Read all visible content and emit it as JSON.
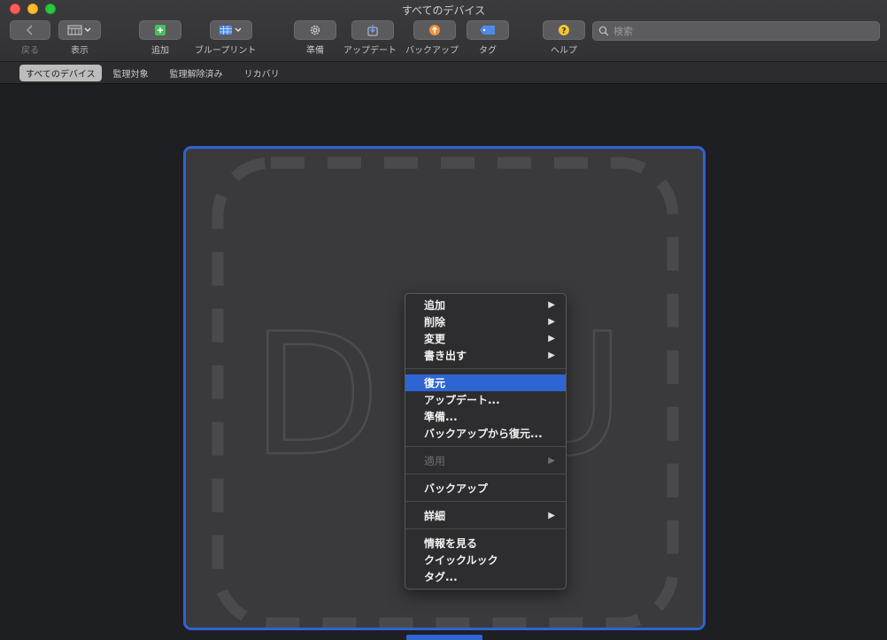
{
  "window": {
    "title": "すべてのデバイス"
  },
  "toolbar": {
    "back_label": "戻る",
    "view_label": "表示",
    "add_label": "追加",
    "blueprint_label": "ブループリント",
    "prepare_label": "準備",
    "update_label": "アップデート",
    "backup_label": "バックアップ",
    "tag_label": "タグ",
    "help_label": "ヘルプ"
  },
  "search": {
    "placeholder": "検索"
  },
  "filters": {
    "all_devices": "すべてのデバイス",
    "supervised": "監理対象",
    "unsupervised": "監理解除済み",
    "recovery": "リカバリ"
  },
  "device": {
    "placeholder_letters": "DFU"
  },
  "context_menu": {
    "add": "追加",
    "remove": "削除",
    "modify": "変更",
    "export": "書き出す",
    "restore": "復元",
    "update": "アップデート...",
    "prepare": "準備...",
    "restore_from_backup": "バックアップから復元...",
    "apply": "適用",
    "backup": "バックアップ",
    "details": "詳細",
    "get_info": "情報を見る",
    "quick_look": "クイックルック",
    "tags": "タグ..."
  },
  "colors": {
    "accent": "#2e64d4",
    "add_icon": "#4bbf5a",
    "backup_icon": "#f0923a",
    "tag_icon": "#4e8be8",
    "help_icon": "#f5c531"
  }
}
